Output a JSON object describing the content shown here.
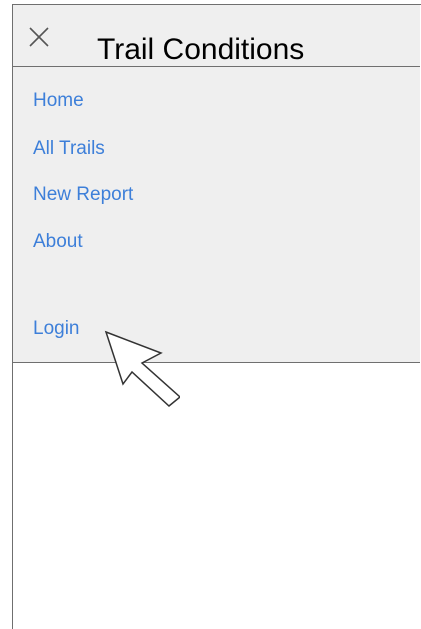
{
  "header": {
    "title": "Trail Conditions",
    "close_icon": "close-icon"
  },
  "nav": {
    "items": [
      {
        "label": "Home"
      },
      {
        "label": "All Trails"
      },
      {
        "label": "New Report"
      },
      {
        "label": "About"
      }
    ],
    "login_label": "Login"
  },
  "cursor_icon": "arrow-cursor-icon",
  "colors": {
    "link": "#3d7fd9",
    "drawer_background": "#efefef",
    "border": "#6f6f6f"
  }
}
